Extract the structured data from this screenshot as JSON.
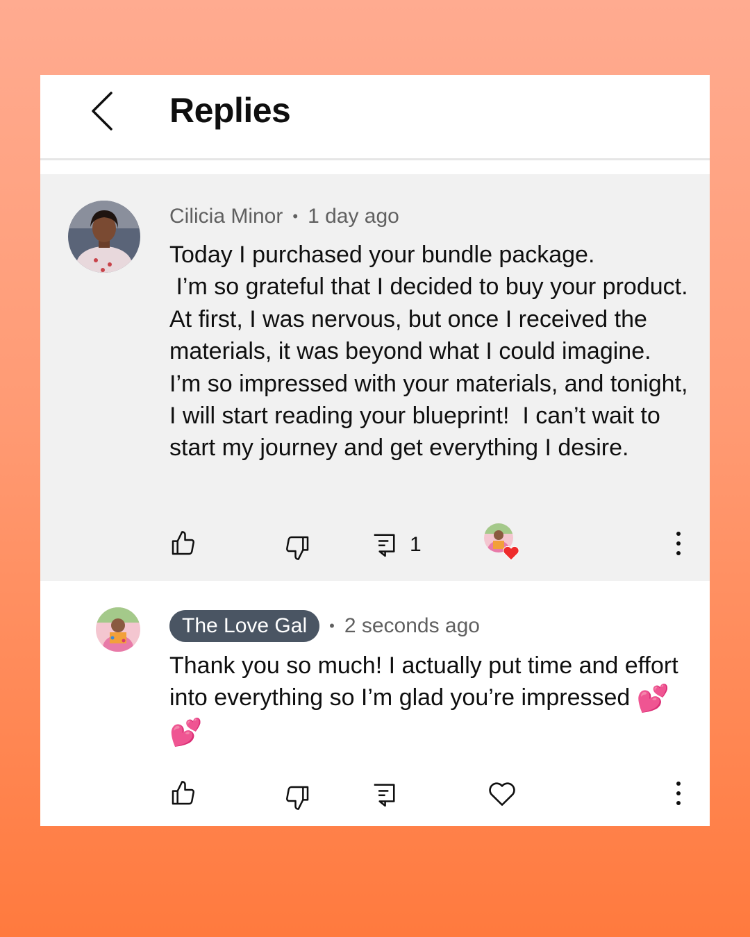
{
  "header": {
    "title": "Replies"
  },
  "comments": [
    {
      "author": "Cilicia Minor",
      "time": "1 day ago",
      "text": "Today I purchased your bundle package.\n I’m so grateful that I decided to buy your product.  At first, I was nervous, but once I received the materials, it was beyond what I could imagine.  I’m so impressed with your materials, and tonight, I will start reading your blueprint!  I can’t wait to start my journey and get everything I desire.",
      "reply_count": "1"
    },
    {
      "author": "The Love Gal",
      "time": "2 seconds ago",
      "text": "Thank you so much! I actually put time and effort into everything so I’m glad you’re impressed",
      "emoji": "💕 💕"
    }
  ],
  "colors": {
    "accent_heart": "#ee2b2b",
    "author_badge": "#4a5563"
  }
}
